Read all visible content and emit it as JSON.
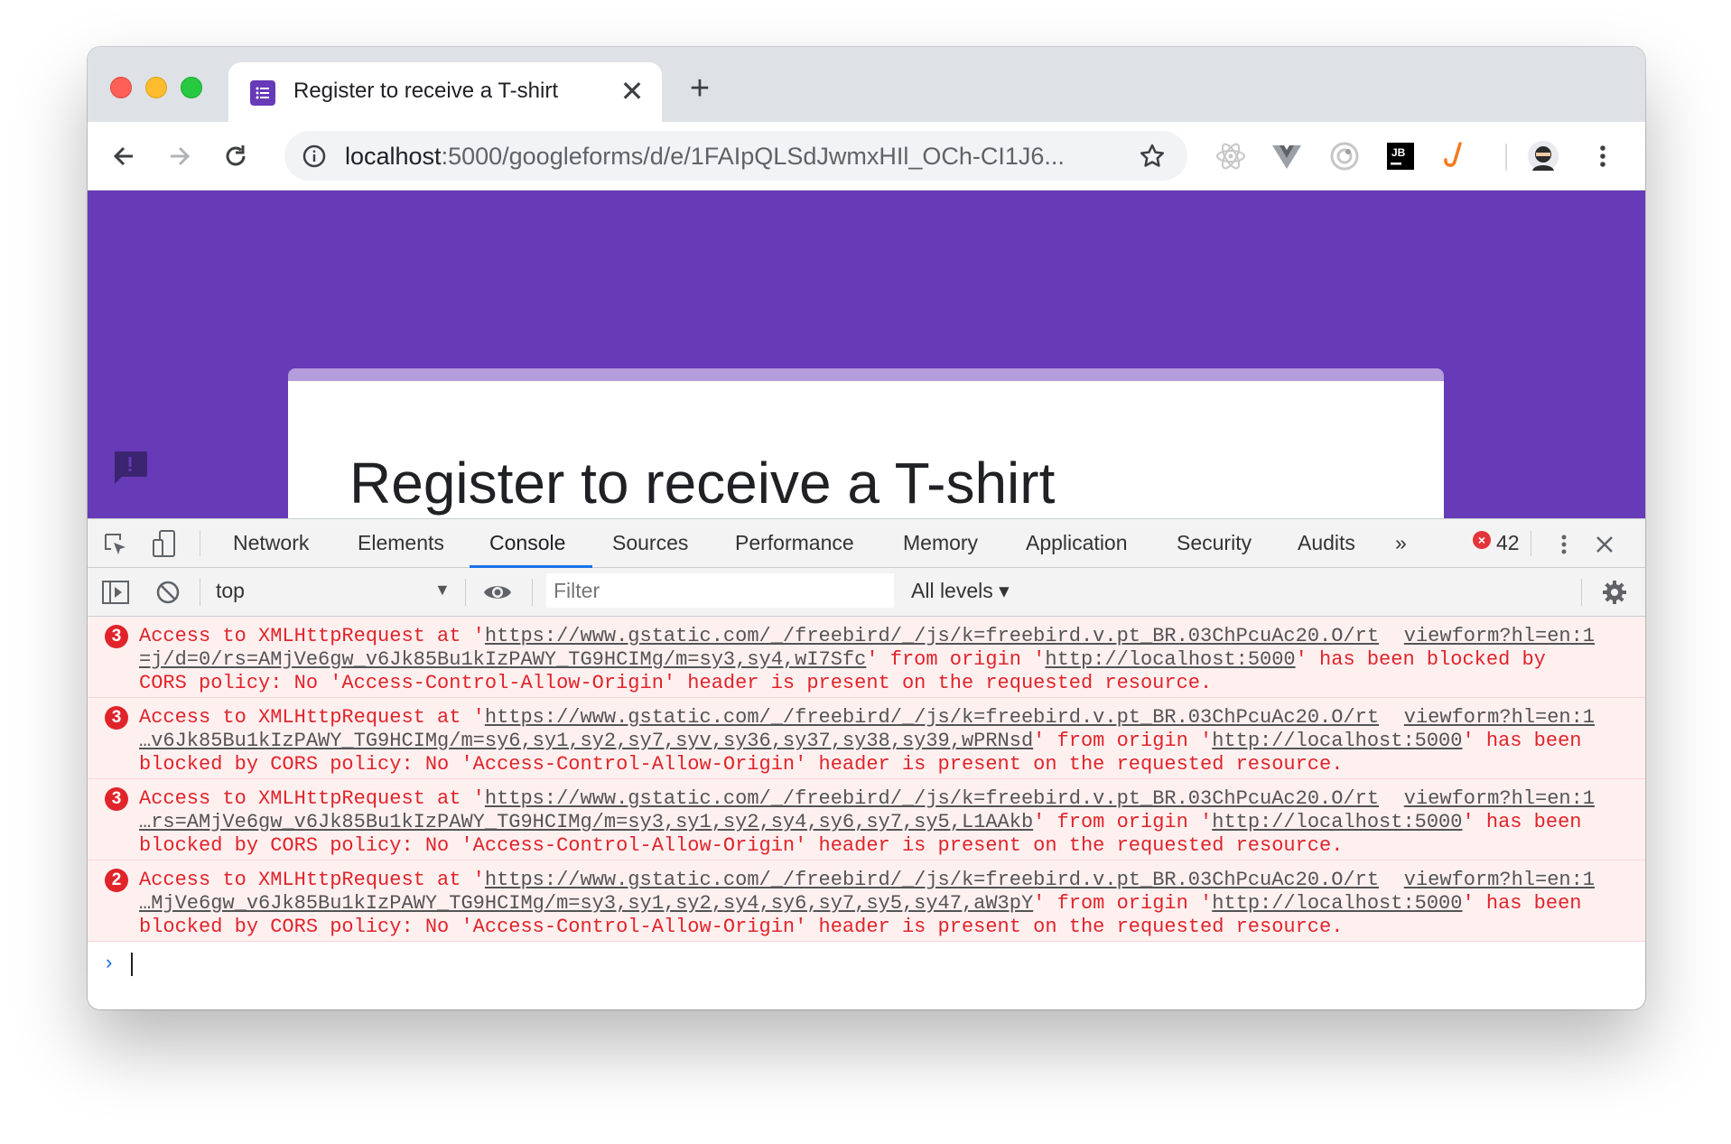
{
  "browser": {
    "tab_title": "Register to receive a T-shirt",
    "tab_close": "✕",
    "new_tab": "+",
    "url_host": "localhost",
    "url_path": ":5000/googleforms/d/e/1FAIpQLSdJwmxHIl_OCh-CI1J6..."
  },
  "page": {
    "form_title": "Register to receive a T-shirt",
    "header_color": "#673ab7",
    "accent_color": "#b39ddb"
  },
  "devtools": {
    "tabs": [
      "Network",
      "Elements",
      "Console",
      "Sources",
      "Performance",
      "Memory",
      "Application",
      "Security",
      "Audits"
    ],
    "active_tab": "Console",
    "more_tabs": "»",
    "error_count": "42",
    "context": "top",
    "filter_placeholder": "Filter",
    "levels": "All levels ▾"
  },
  "console": {
    "messages": [
      {
        "count": "3",
        "line1_pre": "Access to XMLHttpRequest at '",
        "line1_link": "https://www.gstatic.com/_/freebird/_/js/k=freebird.v.pt_BR.03ChPcuAc20.O/rt",
        "line2_link": "=j/d=0/rs=AMjVe6gw_v6Jk85Bu1kIzPAWY_TG9HCIMg/m=sy3,sy4,wI7Sfc",
        "line2_mid": "' from origin '",
        "line2_origin": "http://localhost:5000",
        "line2_post": "' has been blocked by",
        "line3": "CORS policy: No 'Access-Control-Allow-Origin' header is present on the requested resource.",
        "source": "viewform?hl=en:1"
      },
      {
        "count": "3",
        "line1_pre": "Access to XMLHttpRequest at '",
        "line1_link": "https://www.gstatic.com/_/freebird/_/js/k=freebird.v.pt_BR.03ChPcuAc20.O/rt",
        "line2_link": "…v6Jk85Bu1kIzPAWY_TG9HCIMg/m=sy6,sy1,sy2,sy7,syv,sy36,sy37,sy38,sy39,wPRNsd",
        "line2_mid": "' from origin '",
        "line2_origin": "http://localhost:5000",
        "line2_post": "' has been",
        "line3": "blocked by CORS policy: No 'Access-Control-Allow-Origin' header is present on the requested resource.",
        "source": "viewform?hl=en:1"
      },
      {
        "count": "3",
        "line1_pre": "Access to XMLHttpRequest at '",
        "line1_link": "https://www.gstatic.com/_/freebird/_/js/k=freebird.v.pt_BR.03ChPcuAc20.O/rt",
        "line2_link": "…rs=AMjVe6gw_v6Jk85Bu1kIzPAWY_TG9HCIMg/m=sy3,sy1,sy2,sy4,sy6,sy7,sy5,L1AAkb",
        "line2_mid": "' from origin '",
        "line2_origin": "http://localhost:5000",
        "line2_post": "' has been",
        "line3": "blocked by CORS policy: No 'Access-Control-Allow-Origin' header is present on the requested resource.",
        "source": "viewform?hl=en:1"
      },
      {
        "count": "2",
        "line1_pre": "Access to XMLHttpRequest at '",
        "line1_link": "https://www.gstatic.com/_/freebird/_/js/k=freebird.v.pt_BR.03ChPcuAc20.O/rt",
        "line2_link": "…MjVe6gw_v6Jk85Bu1kIzPAWY_TG9HCIMg/m=sy3,sy1,sy2,sy4,sy6,sy7,sy5,sy47,aW3pY",
        "line2_mid": "' from origin '",
        "line2_origin": "http://localhost:5000",
        "line2_post": "' has been",
        "line3": "blocked by CORS policy: No 'Access-Control-Allow-Origin' header is present on the requested resource.",
        "source": "viewform?hl=en:1"
      }
    ],
    "prompt": "›"
  }
}
